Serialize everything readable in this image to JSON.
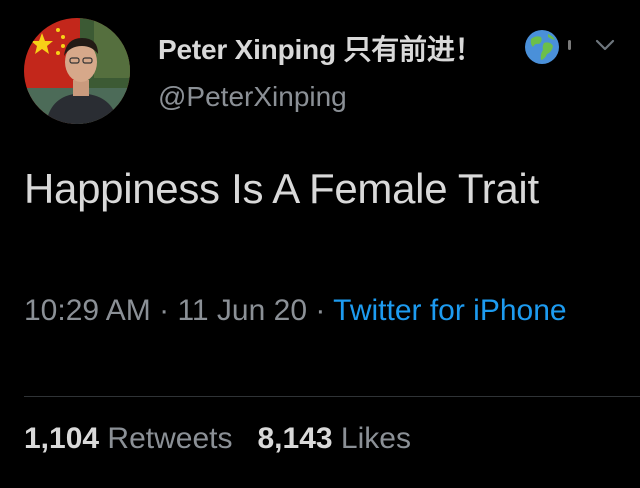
{
  "tweet": {
    "display_name": "Peter Xinping 只有前进！",
    "handle": "@PeterXinping",
    "text": "Happiness Is A Female Trait",
    "time": "10:29 AM",
    "date": "11 Jun 20",
    "separator": "·",
    "source": "Twitter for iPhone"
  },
  "stats": {
    "retweets_count": "1,104",
    "retweets_label": "Retweets",
    "likes_count": "8,143",
    "likes_label": "Likes"
  },
  "icons": {
    "avatar": "profile-avatar",
    "flag": "china-flag",
    "globe": "globe-icon",
    "menu": "chevron-down-icon"
  },
  "colors": {
    "background": "#000000",
    "text": "#d9d9d9",
    "secondary": "#8b9096",
    "accent": "#1d9bf0"
  }
}
